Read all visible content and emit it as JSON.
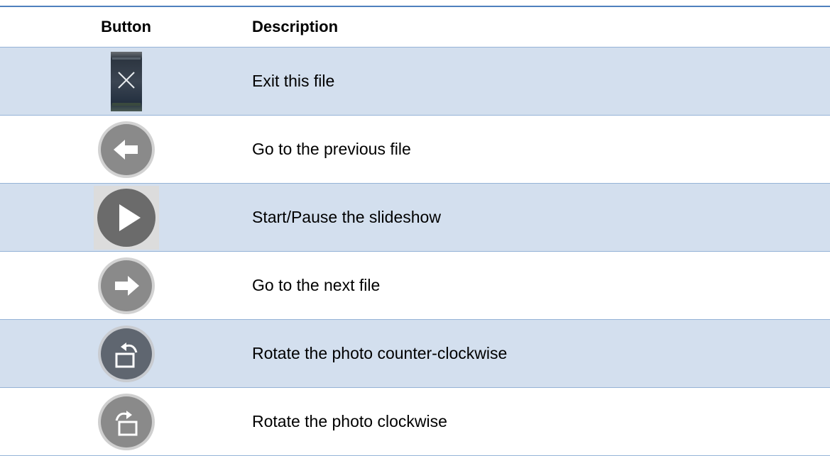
{
  "table": {
    "headers": {
      "button": "Button",
      "description": "Description"
    },
    "rows": [
      {
        "icon": "exit-x-icon",
        "description": "Exit this file"
      },
      {
        "icon": "previous-arrow-icon",
        "description": "Go to the previous file"
      },
      {
        "icon": "play-icon",
        "description": "Start/Pause the slideshow"
      },
      {
        "icon": "next-arrow-icon",
        "description": "Go to the next file"
      },
      {
        "icon": "rotate-counterclockwise-icon",
        "description": "Rotate the photo counter-clockwise"
      },
      {
        "icon": "rotate-clockwise-icon",
        "description": "Rotate the photo clockwise"
      }
    ]
  },
  "colors": {
    "header_rule": "#4f81bd",
    "row_shade": "#d3dfee",
    "row_rule": "#95b3d7"
  }
}
